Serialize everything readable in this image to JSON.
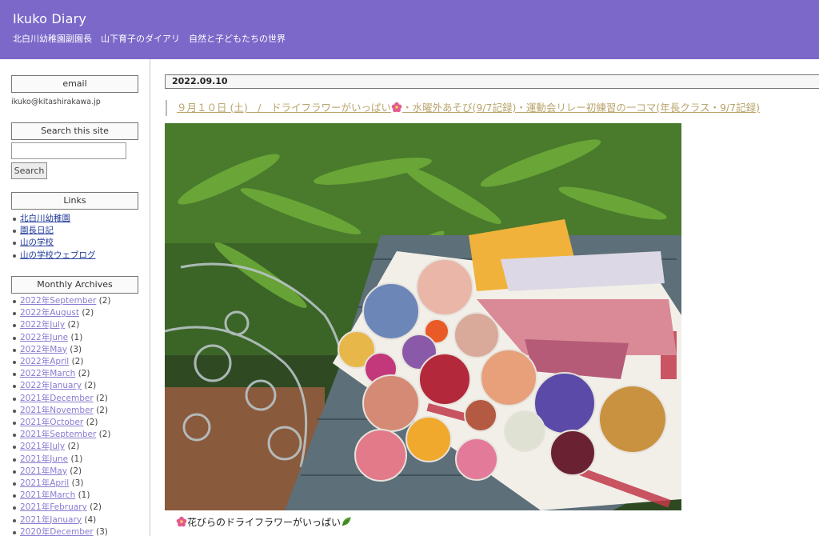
{
  "site": {
    "title": "Ikuko Diary",
    "description": "北白川幼稚園副園長　山下育子のダイアリ　自然と子どもたちの世界"
  },
  "sidebar": {
    "email": {
      "heading": "email",
      "address": "ikuko@kitashirakawa.jp"
    },
    "search": {
      "heading": "Search this site",
      "button_label": "Search",
      "input_value": ""
    },
    "links": {
      "heading": "Links",
      "items": [
        "北白川幼稚園",
        "園長日記",
        "山の学校",
        "山の学校ウェブログ"
      ]
    },
    "archives": {
      "heading": "Monthly Archives",
      "items": [
        {
          "label": "2022年September",
          "count": "(2)"
        },
        {
          "label": "2022年August",
          "count": "(2)"
        },
        {
          "label": "2022年July",
          "count": "(2)"
        },
        {
          "label": "2022年June",
          "count": "(1)"
        },
        {
          "label": "2022年May",
          "count": "(3)"
        },
        {
          "label": "2022年April",
          "count": "(2)"
        },
        {
          "label": "2022年March",
          "count": "(2)"
        },
        {
          "label": "2022年January",
          "count": "(2)"
        },
        {
          "label": "2021年December",
          "count": "(2)"
        },
        {
          "label": "2021年November",
          "count": "(2)"
        },
        {
          "label": "2021年October",
          "count": "(2)"
        },
        {
          "label": "2021年September",
          "count": "(2)"
        },
        {
          "label": "2021年July",
          "count": "(2)"
        },
        {
          "label": "2021年June",
          "count": "(1)"
        },
        {
          "label": "2021年May",
          "count": "(2)"
        },
        {
          "label": "2021年April",
          "count": "(3)"
        },
        {
          "label": "2021年March",
          "count": "(1)"
        },
        {
          "label": "2021年February",
          "count": "(2)"
        },
        {
          "label": "2021年January",
          "count": "(4)"
        },
        {
          "label": "2020年December",
          "count": "(3)"
        }
      ]
    }
  },
  "entry": {
    "date": "2022.09.10",
    "title_part1": "９月１０日 (土)　/　ドライフラワーがいっぱい",
    "title_part2": "・水曜外あそび(9/7記録)・運動会リレー初練習の一コマ(年長クラス・9/7記録)",
    "caption": "花びらのドライフラワーがいっぱい",
    "photo_icon": "dried-flowers-photo"
  },
  "colors": {
    "banner": "#7b68c9",
    "title_link": "#b8a46a",
    "link": "#223b9a",
    "visited_link": "#8a7bd0"
  }
}
